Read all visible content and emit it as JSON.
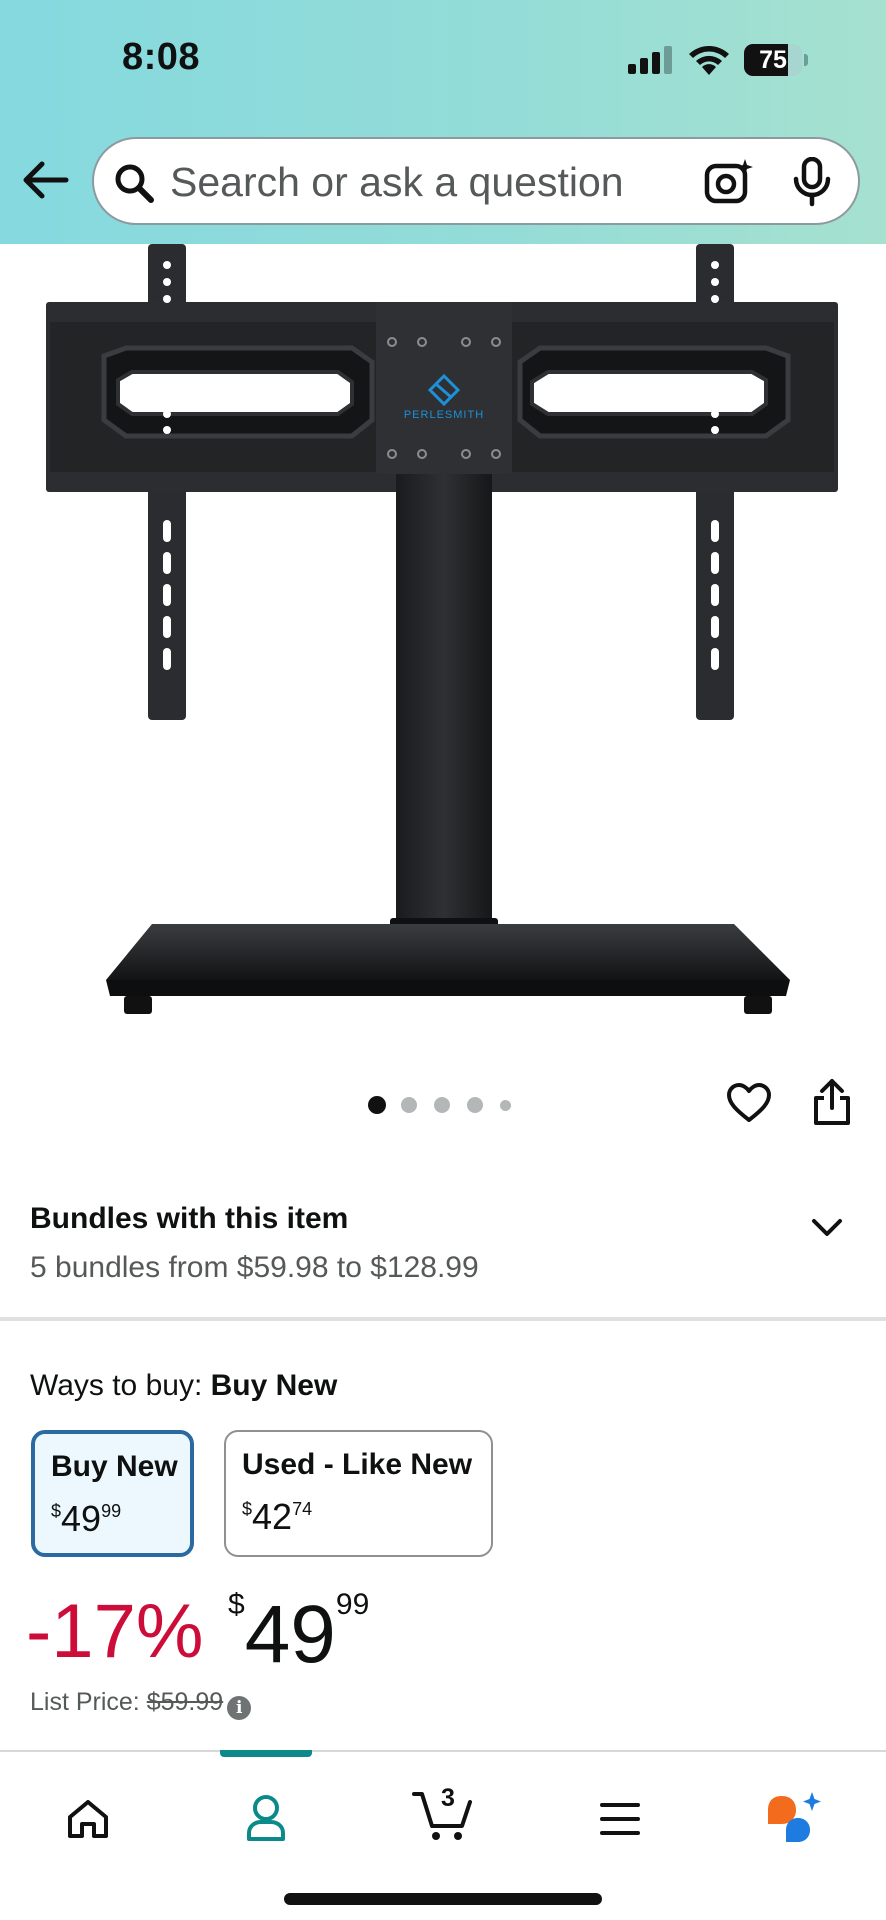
{
  "status_bar": {
    "time": "8:08",
    "battery": "75",
    "battery_level": 0.75
  },
  "search": {
    "placeholder": "Search or ask a question"
  },
  "product": {
    "brand_logo": "PERLESMITH",
    "image_count": 5,
    "current_image": 1
  },
  "bundles": {
    "title": "Bundles with this item",
    "subtitle": "5 bundles from $59.98 to $128.99"
  },
  "ways_to_buy": {
    "label": "Ways to buy:",
    "selected": "Buy New",
    "options": [
      {
        "label": "Buy New",
        "currency": "$",
        "whole": "49",
        "fraction": "99",
        "selected": true
      },
      {
        "label": "Used - Like New",
        "currency": "$",
        "whole": "42",
        "fraction": "74",
        "selected": false
      }
    ]
  },
  "price": {
    "discount": "-17%",
    "currency": "$",
    "whole": "49",
    "fraction": "99",
    "list_price_label": "List Price:",
    "list_price": "$59.99"
  },
  "bottom_nav": {
    "items": [
      {
        "icon": "home-icon"
      },
      {
        "icon": "account-icon",
        "active": true
      },
      {
        "icon": "cart-icon",
        "badge": "3"
      },
      {
        "icon": "menu-icon"
      },
      {
        "icon": "rufus-assistant-icon"
      }
    ]
  },
  "colors": {
    "header_gradient_start": "#85d9df",
    "header_gradient_end": "#a6e1cf",
    "discount": "#cc0c39",
    "selected_border": "#2b6aa1",
    "selected_bg": "#ecf8fd",
    "nav_active": "#0c8a8a"
  }
}
